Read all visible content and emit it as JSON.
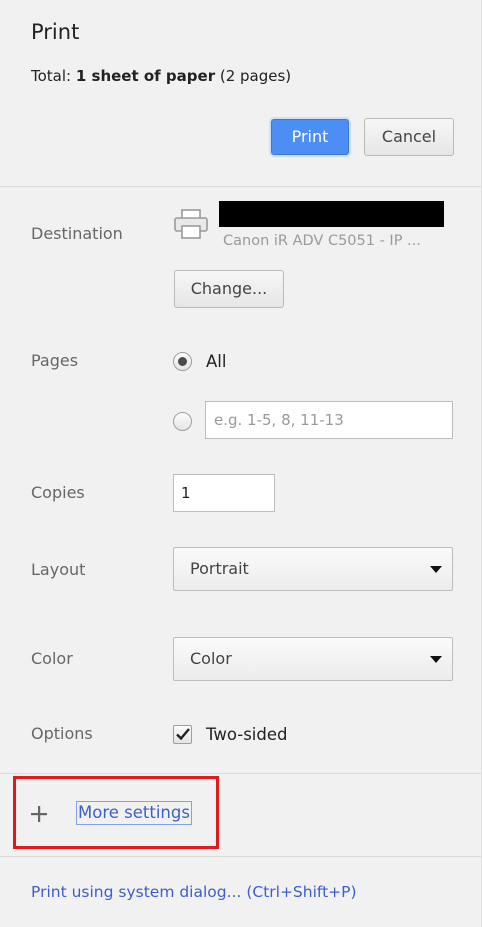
{
  "header": {
    "title": "Print",
    "summary_prefix": "Total: ",
    "summary_bold": "1 sheet of paper",
    "summary_suffix": " (2 pages)",
    "print_label": "Print",
    "cancel_label": "Cancel"
  },
  "destination": {
    "label": "Destination",
    "printer_name": "Canon iR ADV C5051 - IP ...",
    "change_label": "Change..."
  },
  "pages": {
    "label": "Pages",
    "all_label": "All",
    "selected": "All",
    "custom_placeholder": "e.g. 1-5, 8, 11-13"
  },
  "copies": {
    "label": "Copies",
    "value": "1"
  },
  "layout": {
    "label": "Layout",
    "value": "Portrait"
  },
  "color": {
    "label": "Color",
    "value": "Color"
  },
  "options": {
    "label": "Options",
    "two_sided_label": "Two-sided",
    "two_sided_checked": true
  },
  "more_settings": {
    "label": "More settings",
    "highlight_color": "#e01b1b"
  },
  "system_dialog": {
    "label": "Print using system dialog... (Ctrl+Shift+P)"
  },
  "colors": {
    "accent": "#4c8ef4",
    "link": "#3b5fcc"
  }
}
